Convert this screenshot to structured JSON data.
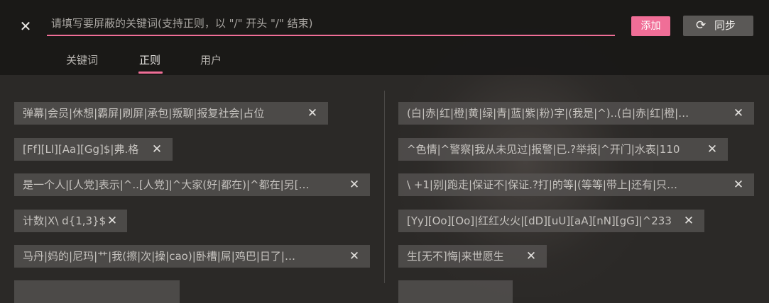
{
  "header": {
    "close_icon": "close-icon",
    "search_placeholder": "请填写要屏蔽的关键词(支持正则，以 \"/\" 开头 \"/\" 结束)",
    "search_value": "",
    "add_label": "添加",
    "sync_icon": "refresh-icon",
    "sync_label": "同步"
  },
  "tabs": [
    {
      "label": "关键词",
      "active": false
    },
    {
      "label": "正则",
      "active": true
    },
    {
      "label": "用户",
      "active": false
    }
  ],
  "colors": {
    "accent": "#f06e97",
    "chip_bg": "#585654",
    "sync_bg": "#5a5856"
  },
  "rules": {
    "left": [
      "弹幕|会员|休想|霸屏|刷屏|承包|叛聊|报复社会|占位",
      "[Ff][Ll][Aa][Gg]$|弗.格",
      "是一个人|[人党]表示|^..[人党]|^大家(好|都在)|^都在|另[…",
      "计数|X\\ d{1,3}$",
      "马丹|妈的|尼玛|艹|我(擦|次|操|cao)|卧槽|屌|鸡巴|日了|…"
    ],
    "right": [
      "(白|赤|红|橙|黄|绿|青|蓝|紫|粉)字|(我是|^)..(白|赤|红|橙|…",
      "^色情|^警察|我从未见过|报警|已.?举报|^开门|水表|110",
      "\\ +1|别|跑走|保证不|保证.?打|的等|(等等|带上|还有|只…",
      "[Yy][Oo][Oo]|红红火火|[dD][uU][aA][nN][gG]|^233",
      "生[无不]悔|来世愿生"
    ]
  }
}
